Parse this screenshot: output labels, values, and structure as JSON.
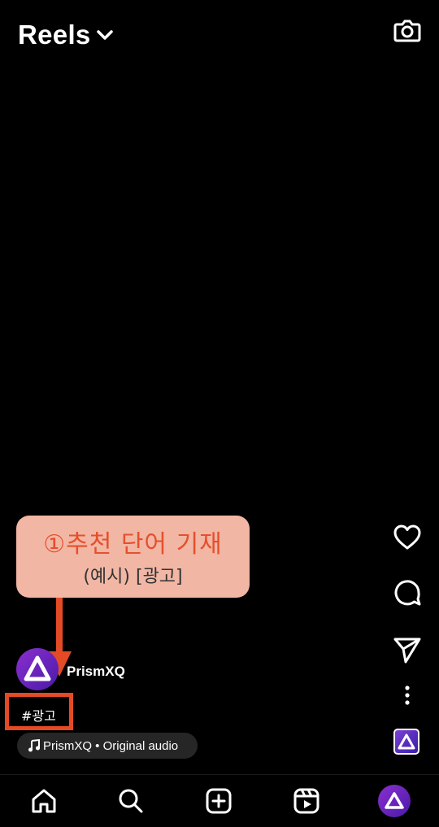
{
  "header": {
    "title": "Reels"
  },
  "callout": {
    "line1": "①추천 단어 기재",
    "line2": "(예시) [광고]"
  },
  "post": {
    "username": "PrismXQ",
    "hashtag": "#광고",
    "audio_label": "PrismXQ • Original audio"
  },
  "icons": {
    "camera": "camera-icon",
    "like": "heart-icon",
    "comment": "comment-icon",
    "share": "send-icon",
    "more": "more-vertical-icon",
    "music": "music-note-icon"
  },
  "nav": {
    "items": [
      "home",
      "search",
      "create",
      "reels",
      "profile"
    ]
  },
  "colors": {
    "accent_red": "#e34a25",
    "callout_bg": "#f2b6a4",
    "brand_purple": "#7a3fd6"
  }
}
